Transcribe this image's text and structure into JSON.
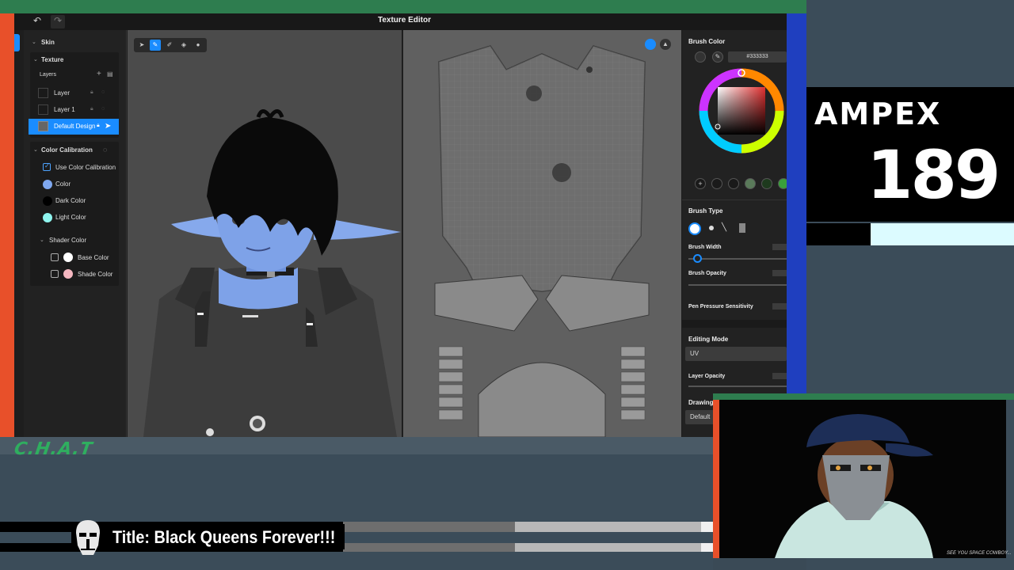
{
  "editor": {
    "window_title": "Texture Editor",
    "undo_icon": "undo-icon",
    "redo_icon": "redo-icon"
  },
  "left_panel": {
    "skin_label": "Skin",
    "texture_label": "Texture",
    "layers_label": "Layers",
    "layers": [
      {
        "label": "Layer"
      },
      {
        "label": "Layer 1"
      },
      {
        "label": "Default Design",
        "selected": true
      }
    ],
    "color_calibration": {
      "header": "Color Calibration",
      "use_label": "Use Color Calibration",
      "use_checked": true,
      "color_label": "Color",
      "dark_label": "Dark Color",
      "light_label": "Light Color",
      "color": "#7fa8ef",
      "dark": "#000000",
      "light": "#8ff5ef"
    },
    "shader_color": {
      "header": "Shader Color",
      "base_label": "Base Color",
      "shade_label": "Shade Color",
      "base": "#ffffff",
      "shade": "#f4b7c0"
    }
  },
  "toolbar": {
    "tools": [
      "select-icon",
      "brush-icon",
      "eraser-icon",
      "fill-icon",
      "dropper-icon"
    ],
    "active": "brush-icon"
  },
  "right_panel": {
    "brush_color_label": "Brush Color",
    "hex_value": "#333333",
    "palette": [
      "#1a1a1a",
      "#1a1a1a",
      "#1a1a1a",
      "#5a7a5a",
      "#1e3a1e",
      "#3aa03a"
    ],
    "brush_type_label": "Brush Type",
    "brush_width_label": "Brush Width",
    "brush_opacity_label": "Brush Opacity",
    "pen_pressure_label": "Pen Pressure Sensitivity",
    "editing_mode_label": "Editing Mode",
    "editing_mode_value": "UV",
    "layer_opacity_label": "Layer Opacity",
    "drawing_mode_label": "Drawing Mode",
    "drawing_mode_value": "Default"
  },
  "overlay": {
    "chat_logo": "C.H.A.T",
    "song_title": "Title: Black Queens Forever!!!",
    "brand": "AMPEX",
    "number": "189",
    "cam_caption": "SEE YOU SPACE COWBOY..."
  },
  "colors": {
    "accent": "#1a8cff",
    "overlay_green": "#2e7d4f",
    "overlay_orange": "#e8502a",
    "overlay_blue": "#1f3fbf"
  }
}
